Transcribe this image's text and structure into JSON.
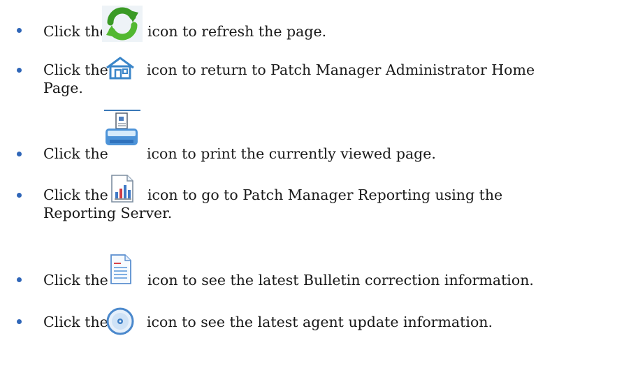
{
  "items": [
    {
      "lead": "Click the",
      "icon": "refresh-icon",
      "text": "icon to refresh the page.",
      "continuation": ""
    },
    {
      "lead": "Click the",
      "icon": "home-icon",
      "text": "icon to return to Patch Manager Administrator Home",
      "continuation": "Page."
    },
    {
      "lead": "Click the",
      "icon": "print-icon",
      "text": "icon to print the currently viewed page.",
      "continuation": ""
    },
    {
      "lead": "Click the",
      "icon": "reporting-icon",
      "text": "icon to go to Patch Manager Reporting using the",
      "continuation": "Reporting Server."
    },
    {
      "lead": "Click the",
      "icon": "bulletin-document-icon",
      "text": "icon to see the latest Bulletin correction information.",
      "continuation": ""
    },
    {
      "lead": "Click the",
      "icon": "agent-update-disc-icon",
      "text": "icon to see the latest agent update information.",
      "continuation": ""
    }
  ]
}
